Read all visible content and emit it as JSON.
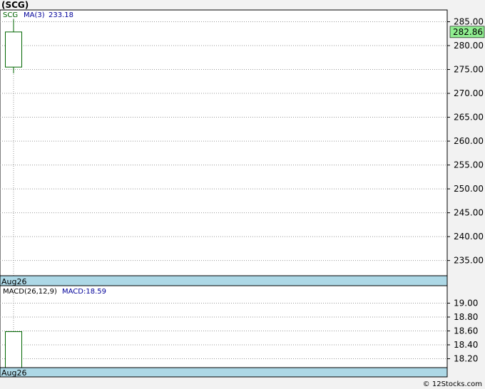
{
  "title": "(SCG)",
  "credit": "© 12Stocks.com",
  "colors": {
    "ticker": "#006600",
    "indicator": "#000099",
    "candle_up": "#ffffff",
    "outline": "#006600",
    "price_badge": "#90ee90",
    "axis_band": "#add8e6",
    "grid": "#999999"
  },
  "chart_data": [
    {
      "type": "candlestick",
      "legend": {
        "ticker": "SCG",
        "ma_label": "MA(3)",
        "ma_value": "233.18"
      },
      "x_labels": [
        "Aug26"
      ],
      "candles": [
        {
          "date": "Aug26",
          "open": 275.5,
          "close": 282.86,
          "high": 285.5,
          "low": 274.2
        }
      ],
      "last_price": "282.86",
      "ylim": [
        231.5,
        287.5
      ],
      "yticks": [
        235,
        240,
        245,
        250,
        255,
        260,
        265,
        270,
        275,
        280,
        285
      ],
      "grid": true
    },
    {
      "type": "bar",
      "legend": {
        "label": "MACD(26,12,9)",
        "value_label": "MACD:18.59"
      },
      "x_labels": [
        "Aug26"
      ],
      "bars": [
        {
          "date": "Aug26",
          "value": 18.59
        }
      ],
      "ylim": [
        18.1,
        19.2
      ],
      "yticks": [
        18.2,
        18.4,
        18.6,
        18.8,
        19.0
      ],
      "grid": true
    }
  ]
}
